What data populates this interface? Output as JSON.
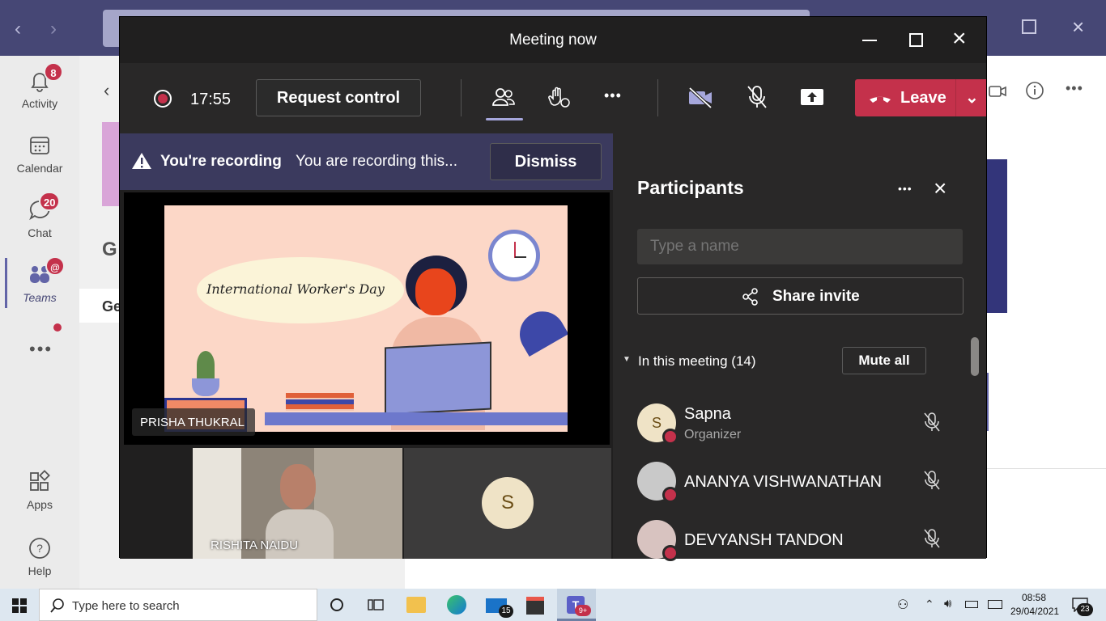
{
  "teams": {
    "rail": [
      {
        "label": "Activity",
        "badge": "8"
      },
      {
        "label": "Calendar",
        "badge": ""
      },
      {
        "label": "Chat",
        "badge": "20"
      },
      {
        "label": "Teams",
        "badge": "@"
      },
      {
        "label": "Apps",
        "badge": ""
      },
      {
        "label": "Help",
        "badge": ""
      }
    ],
    "mid_letter_1": "G",
    "mid_letter_2": "Ge"
  },
  "meeting": {
    "title": "Meeting now",
    "timer": "17:55",
    "request_control": "Request control",
    "leave": "Leave",
    "recording": {
      "title": "You're recording",
      "message": "You are recording this...",
      "dismiss": "Dismiss"
    },
    "shared_screen": {
      "presenter": "PRISHA THUKRAL",
      "slide_text": "International Worker's Day"
    },
    "tiles": [
      {
        "name": "RISHITA NAIDU"
      },
      {
        "initial": "S"
      }
    ]
  },
  "participants": {
    "title": "Participants",
    "search_placeholder": "Type a name",
    "share_invite": "Share invite",
    "section_label": "In this meeting (14)",
    "mute_all": "Mute all",
    "list": [
      {
        "name": "Sapna",
        "role": "Organizer",
        "initial": "S"
      },
      {
        "name": "ANANYA VISHWANATHAN",
        "role": "",
        "initial": ""
      },
      {
        "name": "DEVYANSH TANDON",
        "role": "",
        "initial": ""
      }
    ]
  },
  "taskbar": {
    "search_placeholder": "Type here to search",
    "mail_badge": "15",
    "teams_badge": "9+",
    "time": "08:58",
    "date": "29/04/2021",
    "notifications": "23"
  },
  "colors": {
    "leave": "#c4314b",
    "banner": "#3b3a5e",
    "teams_purple": "#464775"
  }
}
